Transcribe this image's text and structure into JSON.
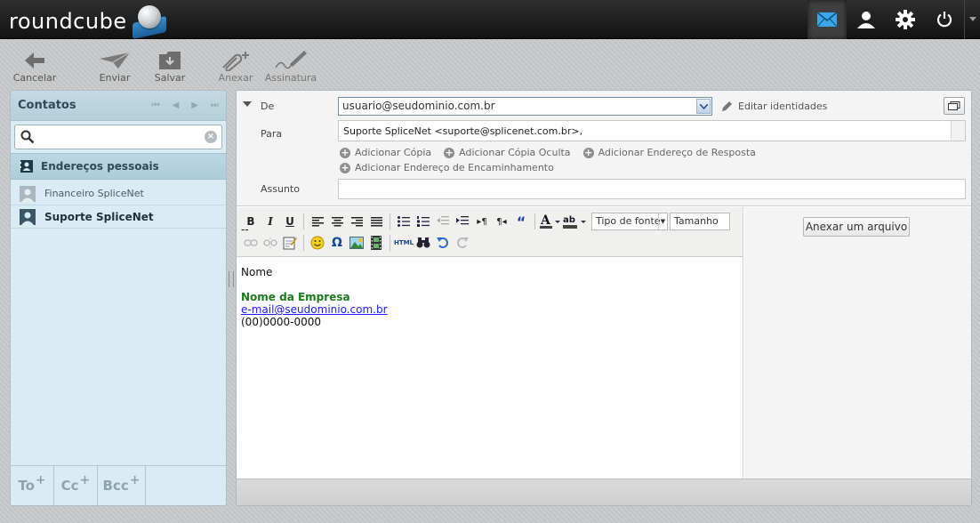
{
  "app": {
    "logo_text": "roundcube"
  },
  "toolbar": {
    "cancel": "Cancelar",
    "send": "Enviar",
    "save": "Salvar",
    "attach": "Anexar",
    "signature": "Assinatura"
  },
  "contacts": {
    "title": "Contatos",
    "search_value": "",
    "group_label": "Endereços pessoais",
    "items": [
      {
        "label": "Financeiro SpliceNet"
      },
      {
        "label": "Suporte SpliceNet"
      }
    ],
    "recipient_buttons": [
      "To",
      "Cc",
      "Bcc"
    ],
    "plus": "+"
  },
  "compose": {
    "from_label": "De",
    "from_value": "usuario@seudominio.com.br",
    "edit_identities": "Editar identidades",
    "to_label": "Para",
    "to_value": "Suporte SpliceNet <suporte@splicenet.com.br>,",
    "add_cc": "Adicionar Cópia",
    "add_bcc": "Adicionar Cópia Oculta",
    "add_reply_to": "Adicionar Endereço de Resposta",
    "add_followup": "Adicionar Endereço de Encaminhamento",
    "subject_label": "Assunto",
    "subject_value": "",
    "font_family": "Tipo de fonte",
    "font_size": "Tamanho",
    "attach_file": "Anexar um arquivo"
  },
  "body": {
    "separator": "--",
    "name": "Nome",
    "company": "Nome da Empresa",
    "email": "e-mail@seudominio.com.br",
    "phone": "(00)0000-0000"
  },
  "editor_buttons": {
    "bold": "B",
    "italic": "I",
    "underline": "U",
    "omega": "Ω",
    "html": "HTML",
    "quote": "“"
  },
  "colors": {
    "accent": "#2f8fd0",
    "company_green": "#1a7a1a",
    "link_blue": "#1a1aff"
  }
}
